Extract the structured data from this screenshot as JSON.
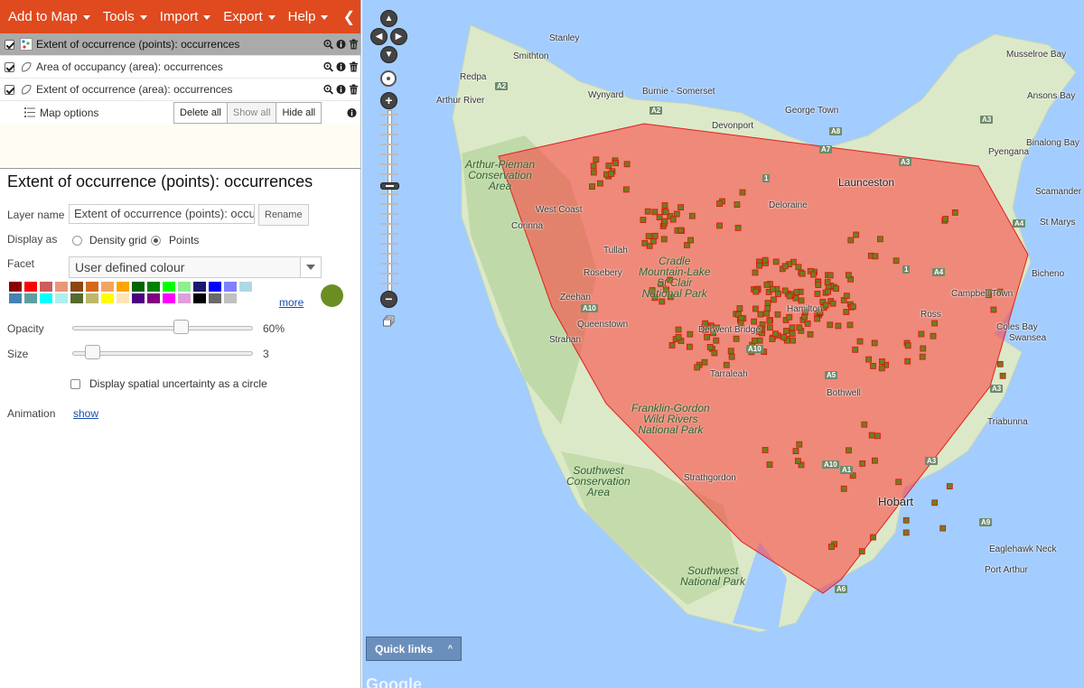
{
  "menu": {
    "items": [
      {
        "label": "Add to Map"
      },
      {
        "label": "Tools"
      },
      {
        "label": "Import"
      },
      {
        "label": "Export"
      },
      {
        "label": "Help"
      }
    ],
    "collapse_glyph": "❮"
  },
  "layers": [
    {
      "name": "Extent of occurrence (points): occurrences",
      "checked": true,
      "selected": true,
      "icon": "points-layer-icon"
    },
    {
      "name": "Area of occupancy (area): occurrences",
      "checked": true,
      "selected": false,
      "icon": "area-layer-icon"
    },
    {
      "name": "Extent of occurrence (area): occurrences",
      "checked": true,
      "selected": false,
      "icon": "area-layer-icon"
    }
  ],
  "layer_controls": {
    "map_options": "Map options",
    "delete_all": "Delete all",
    "show_all": "Show all",
    "hide_all": "Hide all"
  },
  "detail": {
    "title": "Extent of occurrence (points): occurrences",
    "layer_name_label": "Layer name",
    "layer_name_value": "Extent of occurrence (points): occurrences",
    "rename": "Rename",
    "display_as_label": "Display as",
    "density_grid": "Density grid",
    "points": "Points",
    "display_as_selected": "Points",
    "facet_label": "Facet",
    "facet_value": "User defined colour",
    "more": "more",
    "selected_colour": "#6b8e23",
    "palette": [
      "#8b0000",
      "#ff0000",
      "#cd5c5c",
      "#e9967a",
      "#8b4513",
      "#d2691e",
      "#f4a460",
      "#ffa500",
      "#006400",
      "#008000",
      "#00ff00",
      "#90ee90",
      "#191970",
      "#0000ff",
      "#8080ff",
      "#add8e6",
      "#4682b4",
      "#5f9ea0",
      "#00ffff",
      "#afeeee",
      "#556b2f",
      "#bdb76b",
      "#ffff00",
      "#ffe4b5",
      "#4b0082",
      "#800080",
      "#ff00ff",
      "#dda0dd",
      "#000000",
      "#696969",
      "#c0c0c0"
    ],
    "opacity_label": "Opacity",
    "opacity_value": "60%",
    "opacity_fraction": 0.6,
    "size_label": "Size",
    "size_value": "3",
    "uncertainty_label": "Display spatial uncertainty as a circle",
    "animation_label": "Animation",
    "animation_link": "show"
  },
  "map": {
    "quick_links": "Quick links",
    "quick_links_caret": "^",
    "google": "Google",
    "places": [
      "Stanley",
      "Smithton",
      "Redpa",
      "Wynyard",
      "Burnie - Somerset",
      "Arthur River",
      "Devonport",
      "George Town",
      "Musselroe Bay",
      "Ansons Bay",
      "Binalong Bay",
      "Pyengana",
      "Scamander",
      "St Marys",
      "Bicheno",
      "Launceston",
      "Deloraine",
      "West Coast",
      "Corinna",
      "Tullah",
      "Rosebery",
      "Zeehan",
      "Queenstown",
      "Strahan",
      "Derwent Bridge",
      "Tarraleah",
      "Hamilton",
      "Bothwell",
      "Campbell Town",
      "Ross",
      "Coles Bay",
      "Swansea",
      "Triabunna",
      "Strathgordon",
      "Eaglehawk Neck",
      "Port Arthur"
    ],
    "parks": [
      "Arthur-Pieman\nConservation\nArea",
      "Cradle\nMountain-Lake\nSt Clair\nNational Park",
      "Franklin-Gordon\nWild Rivers\nNational Park",
      "Southwest\nConservation\nArea",
      "Southwest\nNational Park"
    ],
    "city": "Hobart",
    "roads": [
      "A2",
      "A2",
      "A8",
      "A7",
      "A3",
      "A3",
      "A3",
      "A4",
      "A4",
      "A10",
      "A10",
      "A5",
      "A10",
      "A1",
      "A3",
      "A9",
      "A6",
      "1",
      "1"
    ]
  }
}
